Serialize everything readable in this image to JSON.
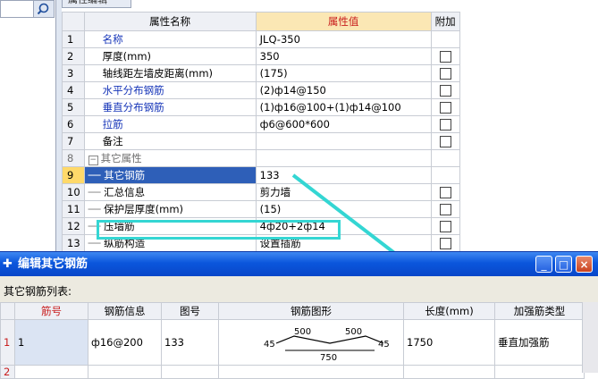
{
  "property_panel": {
    "tab_title": "属性编辑",
    "headers": {
      "name": "属性名称",
      "value": "属性值",
      "extra": "附加"
    },
    "rows": [
      {
        "num": "1",
        "name": "名称",
        "value": "JLQ-350",
        "blue": true,
        "checkbox": false
      },
      {
        "num": "2",
        "name": "厚度(mm)",
        "value": "350",
        "blue": false,
        "checkbox": true
      },
      {
        "num": "3",
        "name": "轴线距左墙皮距离(mm)",
        "value": "(175)",
        "blue": false,
        "checkbox": true
      },
      {
        "num": "4",
        "name": "水平分布钢筋",
        "value": "(2)ф14@150",
        "blue": true,
        "checkbox": true
      },
      {
        "num": "5",
        "name": "垂直分布钢筋",
        "value": "(1)ф16@100+(1)ф14@100",
        "blue": true,
        "checkbox": true
      },
      {
        "num": "6",
        "name": "拉筋",
        "value": "ф6@600*600",
        "blue": true,
        "checkbox": true
      },
      {
        "num": "7",
        "name": "备注",
        "value": "",
        "blue": false,
        "checkbox": true
      },
      {
        "num": "8",
        "name": "其它属性",
        "value": "",
        "blue": false,
        "checkbox": false,
        "group": true
      },
      {
        "num": "9",
        "name": "其它钢筋",
        "value": "133",
        "blue": false,
        "checkbox": false,
        "selected": true,
        "child": true
      },
      {
        "num": "10",
        "name": "汇总信息",
        "value": "剪力墙",
        "blue": false,
        "checkbox": true,
        "child": true
      },
      {
        "num": "11",
        "name": "保护层厚度(mm)",
        "value": "(15)",
        "blue": false,
        "checkbox": true,
        "child": true
      },
      {
        "num": "12",
        "name": "压墙筋",
        "value": "4ф20+2ф14",
        "blue": false,
        "checkbox": true,
        "child": true
      },
      {
        "num": "13",
        "name": "纵筋构造",
        "value": "设置插筋",
        "blue": false,
        "checkbox": true,
        "child": true
      }
    ]
  },
  "dialog": {
    "title": "编辑其它钢筋",
    "list_label": "其它钢筋列表:",
    "columns": [
      "筋号",
      "钢筋信息",
      "图号",
      "钢筋图形",
      "长度(mm)",
      "加强筋类型"
    ],
    "rows": [
      {
        "num": "1",
        "bar_no": "1",
        "info": "ф16@200",
        "fig_no": "133",
        "shape": {
          "left": "45",
          "seg1": "500",
          "seg2": "500",
          "right": "45",
          "bottom": "750"
        },
        "length": "1750",
        "type": "垂直加强筋"
      },
      {
        "num": "2",
        "bar_no": "",
        "info": "",
        "fig_no": "",
        "length": "",
        "type": ""
      }
    ],
    "buttons": {
      "minimize": "_",
      "maximize": "□",
      "close": "×"
    }
  },
  "colors": {
    "accent_cyan": "#34d6d3",
    "title_blue": "#0b56dc",
    "header_red": "#c81d1d",
    "label_blue": "#1534b8"
  }
}
